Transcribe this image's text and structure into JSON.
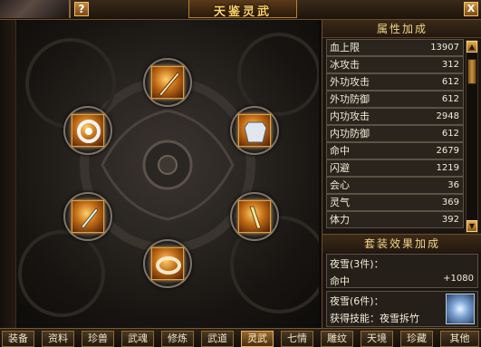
{
  "window": {
    "title": "天鉴灵武",
    "help_label": "?",
    "close_label": "X"
  },
  "attributes": {
    "header": "属性加成",
    "rows": [
      {
        "name": "血上限",
        "value": "13907"
      },
      {
        "name": "冰攻击",
        "value": "312"
      },
      {
        "name": "外功攻击",
        "value": "612"
      },
      {
        "name": "外功防御",
        "value": "612"
      },
      {
        "name": "内功攻击",
        "value": "2948"
      },
      {
        "name": "内功防御",
        "value": "612"
      },
      {
        "name": "命中",
        "value": "2679"
      },
      {
        "name": "闪避",
        "value": "1219"
      },
      {
        "name": "会心",
        "value": "36"
      },
      {
        "name": "灵气",
        "value": "369"
      },
      {
        "name": "体力",
        "value": "392"
      }
    ],
    "scroll_up": "▲",
    "scroll_down": "▼"
  },
  "set_bonus": {
    "header": "套装效果加成",
    "set3_label": "夜雪(3件)：",
    "set3_stat": "命中",
    "set3_value": "+1080",
    "set6_label": "夜雪(6件)：",
    "set6_skill": "获得技能：夜雪拆竹",
    "skill_icon": "ice-skill-icon"
  },
  "slots": [
    {
      "name": "slot-top",
      "icon": "spear-icon"
    },
    {
      "name": "slot-left-upper",
      "icon": "gear-ring-icon"
    },
    {
      "name": "slot-right-upper",
      "icon": "armor-icon"
    },
    {
      "name": "slot-left-lower",
      "icon": "dagger-icon"
    },
    {
      "name": "slot-right-lower",
      "icon": "staff-icon"
    },
    {
      "name": "slot-bottom",
      "icon": "bracelet-icon"
    }
  ],
  "tabs": [
    "装备",
    "资料",
    "珍兽",
    "武魂",
    "修炼",
    "武道",
    "灵武",
    "七情",
    "雕纹",
    "天境",
    "珍藏",
    "其他"
  ],
  "active_tab": "灵武",
  "colors": {
    "gold": "#ffd36a",
    "panel": "#1a1510",
    "tile_glow": "#ffb040"
  }
}
